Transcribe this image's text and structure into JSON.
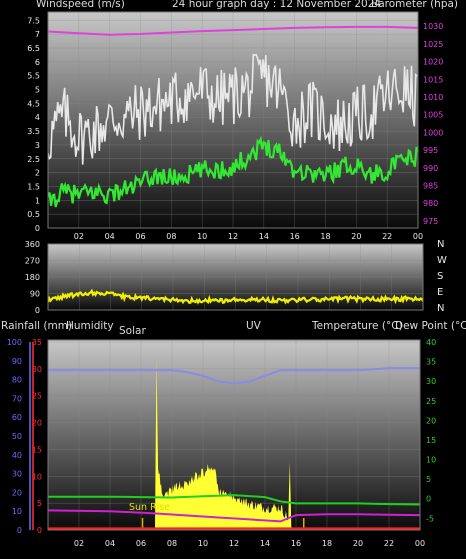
{
  "header": {
    "windspeed_label": "Windspeed (m/s)",
    "title": "24 hour graph day : 12 November 2024",
    "barometer_label": "Barometer (hpa)"
  },
  "chart_data": [
    {
      "type": "line",
      "panel": "wind-baro",
      "x": [
        "02",
        "04",
        "06",
        "08",
        "10",
        "12",
        "14",
        "16",
        "18",
        "20",
        "22",
        "00"
      ],
      "y_left_ticks": [
        "0",
        "0.5",
        "1",
        "1.5",
        "2",
        "2.5",
        "3",
        "3.5",
        "4",
        "4.5",
        "5",
        "5.5",
        "6",
        "6.5",
        "7",
        "7.5"
      ],
      "y_right_ticks": [
        "975",
        "980",
        "985",
        "990",
        "995",
        "1000",
        "1005",
        "1010",
        "1015",
        "1020",
        "1025",
        "1030"
      ],
      "ylim_left": [
        0,
        7.8
      ],
      "ylim_right": [
        973,
        1034
      ],
      "series": [
        {
          "key": "gust",
          "color": "#e8e8e8",
          "axis": "left",
          "anchors": [
            [
              0,
              3.2
            ],
            [
              1,
              4.1
            ],
            [
              2,
              3.3
            ],
            [
              3,
              3.5
            ],
            [
              4,
              3.9
            ],
            [
              5,
              4.0
            ],
            [
              6,
              4.2
            ],
            [
              7,
              4.4
            ],
            [
              8,
              4.6
            ],
            [
              9,
              4.8
            ],
            [
              10,
              5.0
            ],
            [
              11,
              4.6
            ],
            [
              12,
              4.8
            ],
            [
              13,
              5.0
            ],
            [
              14,
              5.5
            ],
            [
              15,
              5.0
            ],
            [
              16,
              3.8
            ],
            [
              17,
              4.3
            ],
            [
              18,
              3.9
            ],
            [
              19,
              3.7
            ],
            [
              20,
              4.0
            ],
            [
              21,
              4.2
            ],
            [
              22,
              4.8
            ],
            [
              23,
              5.0
            ],
            [
              24,
              4.6
            ]
          ]
        },
        {
          "key": "average",
          "color": "#33e833",
          "axis": "left",
          "anchors": [
            [
              0,
              0.9
            ],
            [
              1,
              1.3
            ],
            [
              2,
              1.2
            ],
            [
              3,
              1.3
            ],
            [
              4,
              1.2
            ],
            [
              5,
              1.4
            ],
            [
              6,
              1.6
            ],
            [
              7,
              1.9
            ],
            [
              8,
              1.8
            ],
            [
              9,
              1.9
            ],
            [
              10,
              2.1
            ],
            [
              11,
              2.1
            ],
            [
              12,
              2.2
            ],
            [
              13,
              2.6
            ],
            [
              14,
              3.0
            ],
            [
              15,
              2.8
            ],
            [
              16,
              2.1
            ],
            [
              17,
              2.0
            ],
            [
              18,
              1.9
            ],
            [
              19,
              2.2
            ],
            [
              20,
              2.3
            ],
            [
              21,
              1.9
            ],
            [
              22,
              2.1
            ],
            [
              23,
              2.4
            ],
            [
              24,
              2.6
            ]
          ]
        },
        {
          "key": "pressure",
          "color": "#e040e0",
          "axis": "right",
          "values": [
            [
              0,
              1028.5
            ],
            [
              2,
              1028.0
            ],
            [
              4,
              1027.6
            ],
            [
              6,
              1027.8
            ],
            [
              8,
              1028.2
            ],
            [
              10,
              1028.6
            ],
            [
              12,
              1028.9
            ],
            [
              14,
              1029.2
            ],
            [
              16,
              1029.5
            ],
            [
              18,
              1029.7
            ],
            [
              20,
              1029.8
            ],
            [
              22,
              1029.8
            ],
            [
              24,
              1029.5
            ]
          ]
        }
      ]
    },
    {
      "type": "line",
      "panel": "wind-direction",
      "x": [
        "02",
        "04",
        "06",
        "08",
        "10",
        "12",
        "14",
        "16",
        "18",
        "20",
        "22",
        "00"
      ],
      "y_ticks": [
        "0",
        "90",
        "180",
        "270",
        "360"
      ],
      "compass": [
        "N",
        "W",
        "S",
        "E",
        "N"
      ],
      "ylim": [
        0,
        360
      ],
      "series": [
        {
          "key": "direction",
          "color": "#f0f000",
          "anchors": [
            [
              0,
              55
            ],
            [
              1,
              75
            ],
            [
              2,
              85
            ],
            [
              3,
              95
            ],
            [
              4,
              90
            ],
            [
              5,
              70
            ],
            [
              6,
              65
            ],
            [
              7,
              60
            ],
            [
              8,
              55
            ],
            [
              9,
              50
            ],
            [
              10,
              55
            ],
            [
              11,
              50
            ],
            [
              12,
              55
            ],
            [
              13,
              60
            ],
            [
              14,
              55
            ],
            [
              15,
              52
            ],
            [
              16,
              55
            ],
            [
              17,
              55
            ],
            [
              18,
              58
            ],
            [
              19,
              62
            ],
            [
              20,
              60
            ],
            [
              21,
              58
            ],
            [
              22,
              60
            ],
            [
              23,
              62
            ],
            [
              24,
              60
            ]
          ]
        }
      ]
    },
    {
      "type": "line",
      "panel": "rain-humidity-solar-temp",
      "labels": {
        "rainfall": "Rainfall (mm)",
        "humidity": "Humidity",
        "solar": "Solar",
        "uv": "UV",
        "temperature": "Temperature (°C)",
        "dewpoint": "Dew Point (°C)",
        "sunrise": "Sun Rise"
      },
      "x": [
        "02",
        "04",
        "06",
        "08",
        "10",
        "12",
        "14",
        "16",
        "18",
        "20",
        "22",
        "00"
      ],
      "humidity_ticks": [
        "0",
        "10",
        "20",
        "30",
        "40",
        "50",
        "60",
        "70",
        "80",
        "90",
        "100"
      ],
      "rain_ticks": [
        "0",
        "5",
        "10",
        "15",
        "20",
        "25",
        "30",
        "35"
      ],
      "temp_ticks": [
        "-5",
        "0",
        "5",
        "10",
        "15",
        "20",
        "25",
        "30",
        "35",
        "40"
      ],
      "humidity_lim": [
        0,
        100
      ],
      "rain_lim": [
        0,
        35
      ],
      "temp_lim": [
        -8,
        40
      ],
      "solar": {
        "color": "#ffff33",
        "peak_hour": 7.0,
        "peak_value": 48,
        "profile": [
          [
            6.9,
            0
          ],
          [
            7.0,
            48
          ],
          [
            7.1,
            17
          ],
          [
            7.4,
            9
          ],
          [
            8,
            11
          ],
          [
            9,
            13
          ],
          [
            10,
            16
          ],
          [
            10.8,
            18
          ],
          [
            11,
            10
          ],
          [
            12,
            9
          ],
          [
            13,
            7
          ],
          [
            14,
            6
          ],
          [
            15,
            6
          ],
          [
            15.5,
            3
          ],
          [
            15.6,
            19
          ],
          [
            15.7,
            0
          ]
        ]
      },
      "series": [
        {
          "key": "humidity",
          "color": "#8a8ae8",
          "axis": "humidity",
          "values": [
            [
              0,
              85
            ],
            [
              2,
              85
            ],
            [
              4,
              85
            ],
            [
              6,
              85
            ],
            [
              8,
              85
            ],
            [
              9,
              84
            ],
            [
              10,
              82
            ],
            [
              11,
              79
            ],
            [
              12,
              78
            ],
            [
              13,
              79
            ],
            [
              14,
              82
            ],
            [
              15,
              85
            ],
            [
              16,
              85
            ],
            [
              18,
              85
            ],
            [
              20,
              85
            ],
            [
              22,
              86
            ],
            [
              24,
              86
            ]
          ]
        },
        {
          "key": "temperature",
          "color": "#1fd01f",
          "axis": "temp",
          "values": [
            [
              0,
              0.5
            ],
            [
              2,
              0.5
            ],
            [
              4,
              0.5
            ],
            [
              6,
              0.4
            ],
            [
              8,
              0.3
            ],
            [
              10,
              0.6
            ],
            [
              12,
              0.9
            ],
            [
              14,
              0.4
            ],
            [
              15,
              -0.7
            ],
            [
              16,
              -1.2
            ],
            [
              18,
              -1.2
            ],
            [
              20,
              -1.2
            ],
            [
              22,
              -1.4
            ],
            [
              24,
              -1.5
            ]
          ]
        },
        {
          "key": "dewpoint",
          "color": "#d020d0",
          "axis": "temp",
          "values": [
            [
              0,
              -3.0
            ],
            [
              4,
              -3.2
            ],
            [
              7,
              -3.8
            ],
            [
              9,
              -4.3
            ],
            [
              11,
              -4.8
            ],
            [
              13,
              -5.3
            ],
            [
              15,
              -5.8
            ],
            [
              16,
              -4.2
            ],
            [
              18,
              -4.0
            ],
            [
              20,
              -4.0
            ],
            [
              22,
              -4.1
            ],
            [
              24,
              -4.2
            ]
          ]
        },
        {
          "key": "uv",
          "color": "#ff2020",
          "axis": "rain",
          "values": [
            [
              0,
              0.2
            ],
            [
              24,
              0.2
            ]
          ]
        }
      ]
    }
  ],
  "colors": {
    "panel_top": "#c8c8c8",
    "panel_bottom": "#0a0a0a",
    "humidity_axis": "#6a6aff",
    "rain_axis": "#ff3030",
    "temp_axis": "#33cc33"
  }
}
